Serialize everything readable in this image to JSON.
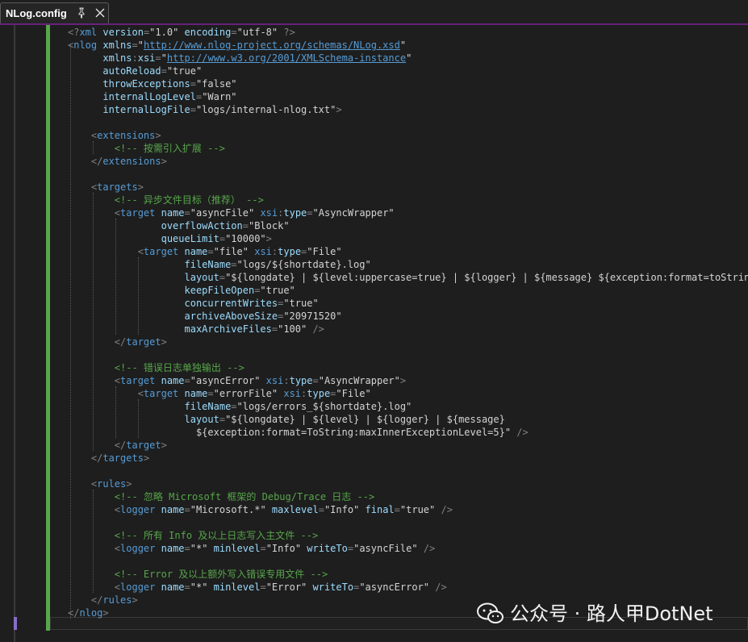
{
  "tab": {
    "title": "NLog.config",
    "pin_icon": "pin-icon",
    "close_icon": "close-icon"
  },
  "colors": {
    "tag": "#569cd6",
    "attr": "#9cdcfe",
    "value": "#d4d4d4",
    "punct": "#808080",
    "comment": "#57a64a",
    "change_bar": "#57a64a"
  },
  "code_lines": [
    [
      [
        "p",
        "<?"
      ],
      [
        "t",
        "xml"
      ],
      [
        "a",
        " version"
      ],
      [
        "p",
        "="
      ],
      [
        "v",
        "\"1.0\""
      ],
      [
        "a",
        " encoding"
      ],
      [
        "p",
        "="
      ],
      [
        "v",
        "\"utf-8\""
      ],
      [
        "p",
        " ?>"
      ]
    ],
    [
      [
        "p",
        "<"
      ],
      [
        "t",
        "nlog"
      ],
      [
        "a",
        " xmlns"
      ],
      [
        "p",
        "="
      ],
      [
        "v",
        "\""
      ],
      [
        "u",
        "http://www.nlog-project.org/schemas/NLog.xsd"
      ],
      [
        "v",
        "\""
      ]
    ],
    [
      [
        "a",
        "      xmlns"
      ],
      [
        "p",
        ":"
      ],
      [
        "a",
        "xsi"
      ],
      [
        "p",
        "="
      ],
      [
        "v",
        "\""
      ],
      [
        "u",
        "http://www.w3.org/2001/XMLSchema-instance"
      ],
      [
        "v",
        "\""
      ]
    ],
    [
      [
        "a",
        "      autoReload"
      ],
      [
        "p",
        "="
      ],
      [
        "v",
        "\"true\""
      ]
    ],
    [
      [
        "a",
        "      throwExceptions"
      ],
      [
        "p",
        "="
      ],
      [
        "v",
        "\"false\""
      ]
    ],
    [
      [
        "a",
        "      internalLogLevel"
      ],
      [
        "p",
        "="
      ],
      [
        "v",
        "\"Warn\""
      ]
    ],
    [
      [
        "a",
        "      internalLogFile"
      ],
      [
        "p",
        "="
      ],
      [
        "v",
        "\"logs/internal-nlog.txt\""
      ],
      [
        "p",
        ">"
      ]
    ],
    [],
    [
      [
        "p",
        "    <"
      ],
      [
        "t",
        "extensions"
      ],
      [
        "p",
        ">"
      ]
    ],
    [
      [
        "c",
        "        <!-- 按需引入扩展 -->"
      ]
    ],
    [
      [
        "p",
        "    </"
      ],
      [
        "t",
        "extensions"
      ],
      [
        "p",
        ">"
      ]
    ],
    [],
    [
      [
        "p",
        "    <"
      ],
      [
        "t",
        "targets"
      ],
      [
        "p",
        ">"
      ]
    ],
    [
      [
        "c",
        "        <!-- 异步文件目标（推荐） -->"
      ]
    ],
    [
      [
        "p",
        "        <"
      ],
      [
        "t",
        "target"
      ],
      [
        "a",
        " name"
      ],
      [
        "p",
        "="
      ],
      [
        "v",
        "\"asyncFile\""
      ],
      [
        "n",
        " xsi"
      ],
      [
        "p",
        ":"
      ],
      [
        "a",
        "type"
      ],
      [
        "p",
        "="
      ],
      [
        "v",
        "\"AsyncWrapper\""
      ]
    ],
    [
      [
        "a",
        "                overflowAction"
      ],
      [
        "p",
        "="
      ],
      [
        "v",
        "\"Block\""
      ]
    ],
    [
      [
        "a",
        "                queueLimit"
      ],
      [
        "p",
        "="
      ],
      [
        "v",
        "\"10000\""
      ],
      [
        "p",
        ">"
      ]
    ],
    [
      [
        "p",
        "            <"
      ],
      [
        "t",
        "target"
      ],
      [
        "a",
        " name"
      ],
      [
        "p",
        "="
      ],
      [
        "v",
        "\"file\""
      ],
      [
        "n",
        " xsi"
      ],
      [
        "p",
        ":"
      ],
      [
        "a",
        "type"
      ],
      [
        "p",
        "="
      ],
      [
        "v",
        "\"File\""
      ]
    ],
    [
      [
        "a",
        "                    fileName"
      ],
      [
        "p",
        "="
      ],
      [
        "v",
        "\"logs/${shortdate}.log\""
      ]
    ],
    [
      [
        "a",
        "                    layout"
      ],
      [
        "p",
        "="
      ],
      [
        "v",
        "\"${longdate} | ${level:uppercase=true} | ${logger} | ${message} ${exception:format=toString}\""
      ]
    ],
    [
      [
        "a",
        "                    keepFileOpen"
      ],
      [
        "p",
        "="
      ],
      [
        "v",
        "\"true\""
      ]
    ],
    [
      [
        "a",
        "                    concurrentWrites"
      ],
      [
        "p",
        "="
      ],
      [
        "v",
        "\"true\""
      ]
    ],
    [
      [
        "a",
        "                    archiveAboveSize"
      ],
      [
        "p",
        "="
      ],
      [
        "v",
        "\"20971520\""
      ]
    ],
    [
      [
        "a",
        "                    maxArchiveFiles"
      ],
      [
        "p",
        "="
      ],
      [
        "v",
        "\"100\""
      ],
      [
        "p",
        " />"
      ]
    ],
    [
      [
        "p",
        "        </"
      ],
      [
        "t",
        "target"
      ],
      [
        "p",
        ">"
      ]
    ],
    [],
    [
      [
        "c",
        "        <!-- 错误日志单独输出 -->"
      ]
    ],
    [
      [
        "p",
        "        <"
      ],
      [
        "t",
        "target"
      ],
      [
        "a",
        " name"
      ],
      [
        "p",
        "="
      ],
      [
        "v",
        "\"asyncError\""
      ],
      [
        "n",
        " xsi"
      ],
      [
        "p",
        ":"
      ],
      [
        "a",
        "type"
      ],
      [
        "p",
        "="
      ],
      [
        "v",
        "\"AsyncWrapper\""
      ],
      [
        "p",
        ">"
      ]
    ],
    [
      [
        "p",
        "            <"
      ],
      [
        "t",
        "target"
      ],
      [
        "a",
        " name"
      ],
      [
        "p",
        "="
      ],
      [
        "v",
        "\"errorFile\""
      ],
      [
        "n",
        " xsi"
      ],
      [
        "p",
        ":"
      ],
      [
        "a",
        "type"
      ],
      [
        "p",
        "="
      ],
      [
        "v",
        "\"File\""
      ]
    ],
    [
      [
        "a",
        "                    fileName"
      ],
      [
        "p",
        "="
      ],
      [
        "v",
        "\"logs/errors_${shortdate}.log\""
      ]
    ],
    [
      [
        "a",
        "                    layout"
      ],
      [
        "p",
        "="
      ],
      [
        "v",
        "\"${longdate} | ${level} | ${logger} | ${message}"
      ]
    ],
    [
      [
        "v",
        "                      ${exception:format=ToString:maxInnerExceptionLevel=5}\""
      ],
      [
        "p",
        " />"
      ]
    ],
    [
      [
        "p",
        "        </"
      ],
      [
        "t",
        "target"
      ],
      [
        "p",
        ">"
      ]
    ],
    [
      [
        "p",
        "    </"
      ],
      [
        "t",
        "targets"
      ],
      [
        "p",
        ">"
      ]
    ],
    [],
    [
      [
        "p",
        "    <"
      ],
      [
        "t",
        "rules"
      ],
      [
        "p",
        ">"
      ]
    ],
    [
      [
        "c",
        "        <!-- 忽略 Microsoft 框架的 Debug/Trace 日志 -->"
      ]
    ],
    [
      [
        "p",
        "        <"
      ],
      [
        "t",
        "logger"
      ],
      [
        "a",
        " name"
      ],
      [
        "p",
        "="
      ],
      [
        "v",
        "\"Microsoft.*\""
      ],
      [
        "a",
        " maxlevel"
      ],
      [
        "p",
        "="
      ],
      [
        "v",
        "\"Info\""
      ],
      [
        "a",
        " final"
      ],
      [
        "p",
        "="
      ],
      [
        "v",
        "\"true\""
      ],
      [
        "p",
        " />"
      ]
    ],
    [],
    [
      [
        "c",
        "        <!-- 所有 Info 及以上日志写入主文件 -->"
      ]
    ],
    [
      [
        "p",
        "        <"
      ],
      [
        "t",
        "logger"
      ],
      [
        "a",
        " name"
      ],
      [
        "p",
        "="
      ],
      [
        "v",
        "\"*\""
      ],
      [
        "a",
        " minlevel"
      ],
      [
        "p",
        "="
      ],
      [
        "v",
        "\"Info\""
      ],
      [
        "a",
        " writeTo"
      ],
      [
        "p",
        "="
      ],
      [
        "v",
        "\"asyncFile\""
      ],
      [
        "p",
        " />"
      ]
    ],
    [],
    [
      [
        "c",
        "        <!-- Error 及以上额外写入错误专用文件 -->"
      ]
    ],
    [
      [
        "p",
        "        <"
      ],
      [
        "t",
        "logger"
      ],
      [
        "a",
        " name"
      ],
      [
        "p",
        "="
      ],
      [
        "v",
        "\"*\""
      ],
      [
        "a",
        " minlevel"
      ],
      [
        "p",
        "="
      ],
      [
        "v",
        "\"Error\""
      ],
      [
        "a",
        " writeTo"
      ],
      [
        "p",
        "="
      ],
      [
        "v",
        "\"asyncError\""
      ],
      [
        "p",
        " />"
      ]
    ],
    [
      [
        "p",
        "    </"
      ],
      [
        "t",
        "rules"
      ],
      [
        "p",
        ">"
      ]
    ],
    [
      [
        "p",
        "</"
      ],
      [
        "t",
        "nlog"
      ],
      [
        "p",
        ">"
      ]
    ]
  ],
  "watermark": {
    "text": "公众号 · 路人甲DotNet",
    "icon": "wechat-icon"
  }
}
